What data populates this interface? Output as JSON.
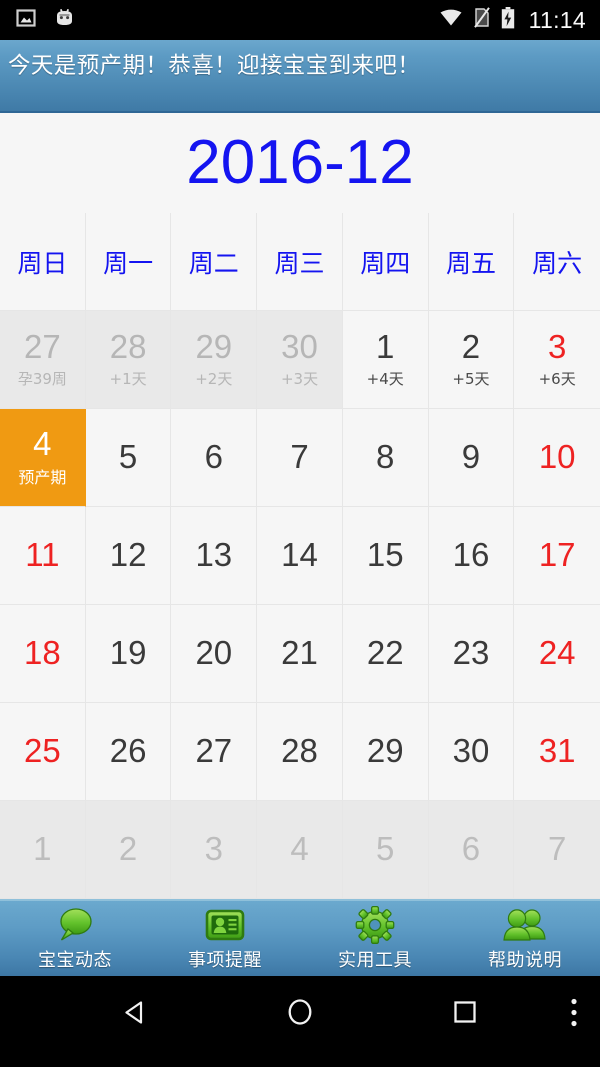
{
  "status_bar": {
    "time": "11:14",
    "icons": [
      "image-icon",
      "android-head-icon",
      "wifi-icon",
      "no-sim-icon",
      "battery-charging-icon"
    ]
  },
  "notice_banner": {
    "text": "今天是预产期！恭喜！迎接宝宝到来吧！",
    "background_top": "#6ba7cd",
    "background_bottom": "#3f7aa6"
  },
  "calendar": {
    "title": "2016-12",
    "title_color": "#1414f0",
    "weekdays": [
      "周日",
      "周一",
      "周二",
      "周三",
      "周四",
      "周五",
      "周六"
    ],
    "accent_color": "#f09a12",
    "weekend_color": "#ee2222",
    "weeks": [
      [
        {
          "day": "27",
          "sub": "孕39周",
          "type": "other"
        },
        {
          "day": "28",
          "sub": "+1天",
          "type": "other"
        },
        {
          "day": "29",
          "sub": "+2天",
          "type": "other"
        },
        {
          "day": "30",
          "sub": "+3天",
          "type": "other"
        },
        {
          "day": "1",
          "sub": "+4天",
          "type": "normal"
        },
        {
          "day": "2",
          "sub": "+5天",
          "type": "normal"
        },
        {
          "day": "3",
          "sub": "+6天",
          "type": "weekend"
        }
      ],
      [
        {
          "day": "4",
          "sub": "预产期",
          "type": "due"
        },
        {
          "day": "5",
          "sub": "",
          "type": "normal"
        },
        {
          "day": "6",
          "sub": "",
          "type": "normal"
        },
        {
          "day": "7",
          "sub": "",
          "type": "normal"
        },
        {
          "day": "8",
          "sub": "",
          "type": "normal"
        },
        {
          "day": "9",
          "sub": "",
          "type": "normal"
        },
        {
          "day": "10",
          "sub": "",
          "type": "weekend"
        }
      ],
      [
        {
          "day": "11",
          "sub": "",
          "type": "weekend"
        },
        {
          "day": "12",
          "sub": "",
          "type": "normal"
        },
        {
          "day": "13",
          "sub": "",
          "type": "normal"
        },
        {
          "day": "14",
          "sub": "",
          "type": "normal"
        },
        {
          "day": "15",
          "sub": "",
          "type": "normal"
        },
        {
          "day": "16",
          "sub": "",
          "type": "normal"
        },
        {
          "day": "17",
          "sub": "",
          "type": "weekend"
        }
      ],
      [
        {
          "day": "18",
          "sub": "",
          "type": "weekend"
        },
        {
          "day": "19",
          "sub": "",
          "type": "normal"
        },
        {
          "day": "20",
          "sub": "",
          "type": "normal"
        },
        {
          "day": "21",
          "sub": "",
          "type": "normal"
        },
        {
          "day": "22",
          "sub": "",
          "type": "normal"
        },
        {
          "day": "23",
          "sub": "",
          "type": "normal"
        },
        {
          "day": "24",
          "sub": "",
          "type": "weekend"
        }
      ],
      [
        {
          "day": "25",
          "sub": "",
          "type": "weekend"
        },
        {
          "day": "26",
          "sub": "",
          "type": "normal"
        },
        {
          "day": "27",
          "sub": "",
          "type": "normal"
        },
        {
          "day": "28",
          "sub": "",
          "type": "normal"
        },
        {
          "day": "29",
          "sub": "",
          "type": "normal"
        },
        {
          "day": "30",
          "sub": "",
          "type": "normal"
        },
        {
          "day": "31",
          "sub": "",
          "type": "weekend"
        }
      ],
      [
        {
          "day": "1",
          "sub": "",
          "type": "trail"
        },
        {
          "day": "2",
          "sub": "",
          "type": "trail"
        },
        {
          "day": "3",
          "sub": "",
          "type": "trail"
        },
        {
          "day": "4",
          "sub": "",
          "type": "trail"
        },
        {
          "day": "5",
          "sub": "",
          "type": "trail"
        },
        {
          "day": "6",
          "sub": "",
          "type": "trail"
        },
        {
          "day": "7",
          "sub": "",
          "type": "trail"
        }
      ]
    ]
  },
  "tab_bar": {
    "items": [
      {
        "label": "宝宝动态",
        "icon": "speech-bubble-icon"
      },
      {
        "label": "事项提醒",
        "icon": "contact-card-icon"
      },
      {
        "label": "实用工具",
        "icon": "gear-icon"
      },
      {
        "label": "帮助说明",
        "icon": "people-icon"
      }
    ],
    "icon_color": "#5cc12a"
  },
  "nav_bar": {
    "buttons": [
      "back-icon",
      "home-icon",
      "recents-icon",
      "overflow-menu-icon"
    ]
  }
}
